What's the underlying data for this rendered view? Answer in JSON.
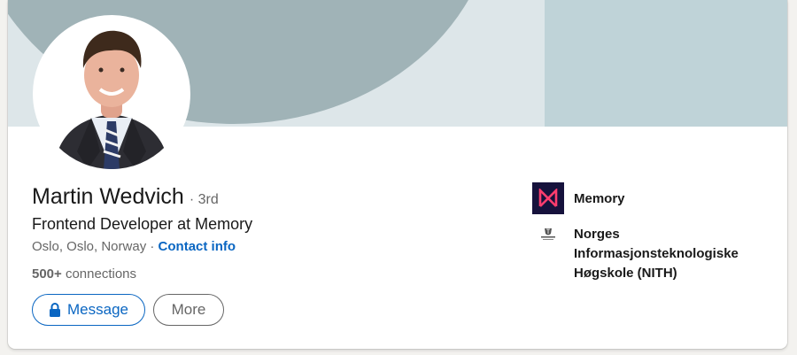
{
  "profile": {
    "name": "Martin Wedvich",
    "degree": "· 3rd",
    "headline": "Frontend Developer at Memory",
    "location": "Oslo, Oslo, Norway ·",
    "contact_info": "Contact info",
    "connections_count": "500+",
    "connections_label": "connections"
  },
  "actions": {
    "message_label": "Message",
    "more_label": "More"
  },
  "organizations": [
    {
      "name": "Memory",
      "logo": "memory-logo"
    },
    {
      "name": "Norges Informasjonsteknologiske Høgskole (NITH)",
      "logo": "nith-crest-logo"
    }
  ],
  "colors": {
    "accent": "#0a66c2",
    "banner_dark": "#a0b3b7",
    "banner_light": "#dde6e9",
    "banner_block": "#bfd3d8",
    "memory_brand_bg": "#16123c",
    "memory_brand_mark": "#ff3d6e"
  }
}
